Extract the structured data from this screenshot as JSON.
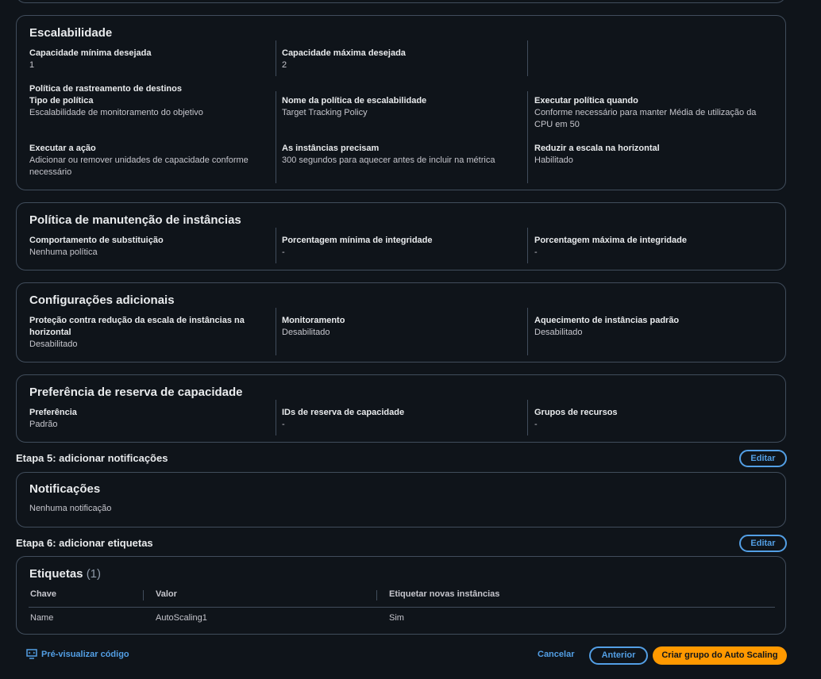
{
  "scalability": {
    "title": "Escalabilidade",
    "min_label": "Capacidade mínima desejada",
    "min_value": "1",
    "max_label": "Capacidade máxima desejada",
    "max_value": "2",
    "tracking_heading": "Política de rastreamento de destinos",
    "policy_type_label": "Tipo de política",
    "policy_type_value": "Escalabilidade de monitoramento do objetivo",
    "policy_name_label": "Nome da política de escalabilidade",
    "policy_name_value": "Target Tracking Policy",
    "execute_when_label": "Executar política quando",
    "execute_when_value": "Conforme necessário para manter Média de utilização da CPU em 50",
    "action_label": "Executar a ação",
    "action_value": "Adicionar ou remover unidades de capacidade conforme necessário",
    "warmup_label": "As instâncias precisam",
    "warmup_value": "300 segundos para aquecer antes de incluir na métrica",
    "scale_in_label": "Reduzir a escala na horizontal",
    "scale_in_value": "Habilitado"
  },
  "maintenance": {
    "title": "Política de manutenção de instâncias",
    "replacement_label": "Comportamento de substituição",
    "replacement_value": "Nenhuma política",
    "min_health_label": "Porcentagem mínima de integridade",
    "min_health_value": "-",
    "max_health_label": "Porcentagem máxima de integridade",
    "max_health_value": "-"
  },
  "additional": {
    "title": "Configurações adicionais",
    "protection_label": "Proteção contra redução da escala de instâncias na horizontal",
    "protection_value": "Desabilitado",
    "monitoring_label": "Monitoramento",
    "monitoring_value": "Desabilitado",
    "warmup_label": "Aquecimento de instâncias padrão",
    "warmup_value": "Desabilitado"
  },
  "reservation": {
    "title": "Preferência de reserva de capacidade",
    "preference_label": "Preferência",
    "preference_value": "Padrão",
    "ids_label": "IDs de reserva de capacidade",
    "ids_value": "-",
    "groups_label": "Grupos de recursos",
    "groups_value": "-"
  },
  "step5": {
    "title": "Etapa 5: adicionar notificações",
    "edit_label": "Editar",
    "card_title": "Notificações",
    "card_value": "Nenhuma notificação"
  },
  "step6": {
    "title": "Etapa 6: adicionar etiquetas",
    "edit_label": "Editar",
    "card_title": "Etiquetas",
    "count": "(1)",
    "columns": [
      "Chave",
      "Valor",
      "Etiquetar novas instâncias"
    ],
    "rows": [
      [
        "Name",
        "AutoScaling1",
        "Sim"
      ]
    ]
  },
  "footer": {
    "preview_label": "Pré-visualizar código",
    "cancel_label": "Cancelar",
    "previous_label": "Anterior",
    "create_label": "Criar grupo do Auto Scaling"
  },
  "colors": {
    "background": "#0f141a",
    "border": "#414d5c",
    "link": "#539fe5",
    "primary_button": "#ff9900"
  },
  "icons": {
    "preview": "code-preview-icon"
  }
}
